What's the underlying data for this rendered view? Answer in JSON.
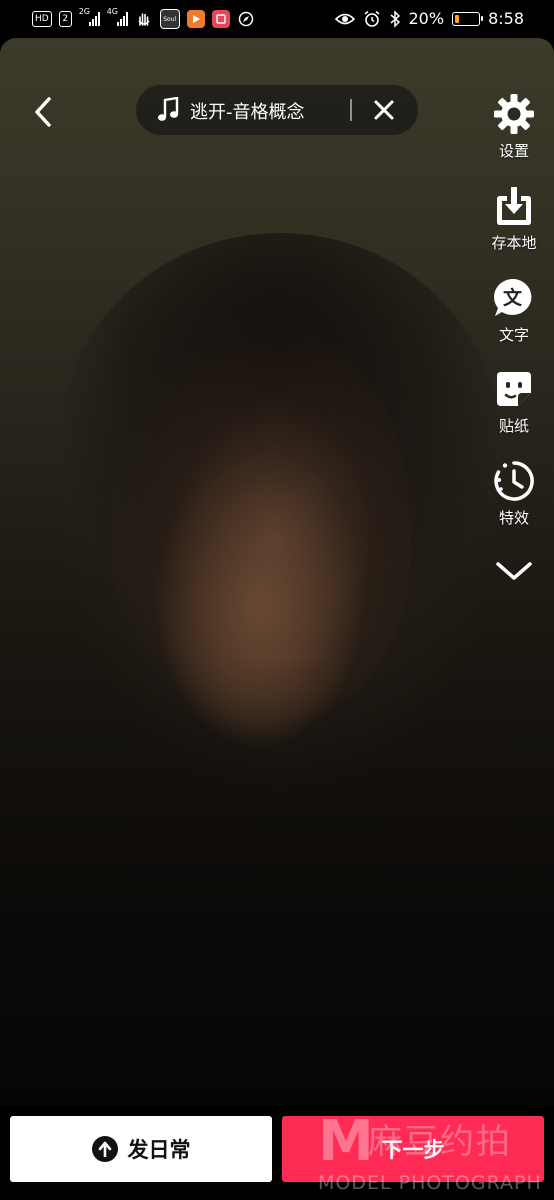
{
  "status_bar": {
    "hd_label": "HD",
    "sim2_label": "2",
    "net1": "2G",
    "net2": "4G",
    "app_soul": "Soul",
    "battery_percent": "20%",
    "battery_level": 0.2,
    "time": "8:58",
    "battery_color": "#ffa321"
  },
  "music": {
    "title": "逃开-音格概念"
  },
  "side_tools": [
    {
      "id": "settings",
      "label": "设置",
      "icon": "gear-icon"
    },
    {
      "id": "save-local",
      "label": "存本地",
      "icon": "download-icon"
    },
    {
      "id": "text",
      "label": "文字",
      "icon": "text-bubble-icon",
      "glyph": "文"
    },
    {
      "id": "sticker",
      "label": "贴纸",
      "icon": "sticker-icon"
    },
    {
      "id": "effects",
      "label": "特效",
      "icon": "timer-effect-icon"
    }
  ],
  "bottom": {
    "daily_label": "发日常",
    "next_label": "下一步",
    "accent_color": "#fe2c55"
  },
  "watermark": {
    "letter": "M",
    "cn": "麻豆约拍",
    "en": "MODEL PHOTOGRAPH"
  }
}
